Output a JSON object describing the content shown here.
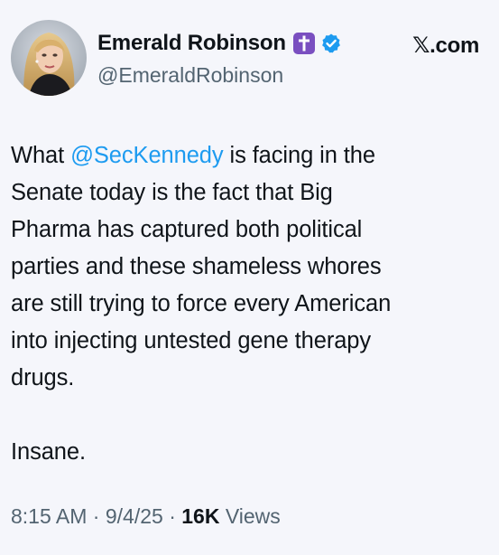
{
  "author": {
    "display_name": "Emerald Robinson",
    "handle": "@EmeraldRobinson",
    "name_emoji": "latin-cross-emoji",
    "verified_icon": "verified-badge-icon"
  },
  "site_label": "𝕏.com",
  "tweet": {
    "line1_prefix": "What ",
    "mention": "@SecKennedy",
    "line1_suffix": " is facing in the",
    "line2": "Senate today is the fact that Big",
    "line3": "Pharma has captured both political",
    "line4": "parties and these shameless whores",
    "line5": "are still trying to force every American",
    "line6": "into injecting untested gene therapy",
    "line7": "drugs.",
    "line8": "Insane."
  },
  "meta": {
    "time": "8:15 AM",
    "date": "9/4/25",
    "views_count": "16K",
    "views_label": "Views"
  },
  "colors": {
    "background": "#f5f6fb",
    "text": "#0f1419",
    "secondary": "#536471",
    "mention": "#1d9bf0",
    "verified": "#1d9bf0",
    "emoji_bg": "#7a4fc0"
  }
}
